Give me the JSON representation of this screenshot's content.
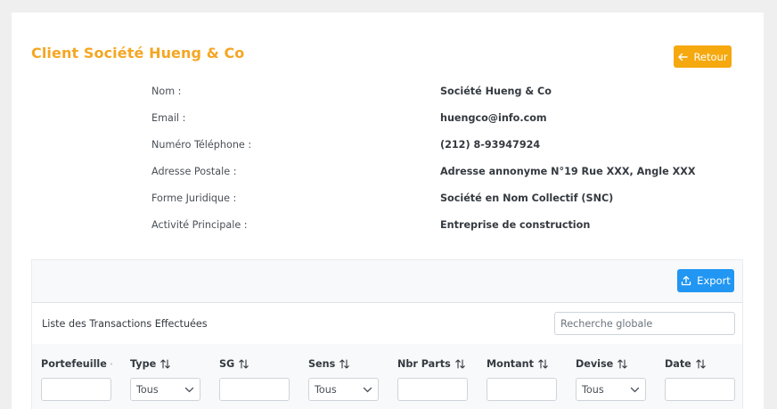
{
  "header": {
    "title": "Client Société Hueng & Co",
    "back_label": "Retour",
    "back_icon": "arrow-left-icon"
  },
  "client_info": [
    {
      "label": "Nom :",
      "value": "Société Hueng & Co"
    },
    {
      "label": "Email :",
      "value": "huengco@info.com"
    },
    {
      "label": "Numéro Téléphone :",
      "value": "(212) 8-93947924"
    },
    {
      "label": "Adresse Postale :",
      "value": "Adresse annonyme N°19 Rue XXX, Angle XXX"
    },
    {
      "label": "Forme Juridique :",
      "value": "Société en Nom Collectif (SNC)"
    },
    {
      "label": "Activité Principale :",
      "value": "Entreprise de construction"
    }
  ],
  "transactions": {
    "export_label": "Export",
    "export_icon": "upload-icon",
    "list_title": "Liste des Transactions Effectuées",
    "search_placeholder": "Recherche globale",
    "columns": [
      {
        "label": "Portefeuille",
        "filter": "input",
        "value": ""
      },
      {
        "label": "Type",
        "filter": "select",
        "value": "Tous"
      },
      {
        "label": "SG",
        "filter": "input",
        "value": ""
      },
      {
        "label": "Sens",
        "filter": "select",
        "value": "Tous"
      },
      {
        "label": "Nbr Parts",
        "filter": "input",
        "value": ""
      },
      {
        "label": "Montant",
        "filter": "input",
        "value": ""
      },
      {
        "label": "Devise",
        "filter": "select",
        "value": "Tous"
      },
      {
        "label": "Date",
        "filter": "input",
        "value": ""
      }
    ]
  },
  "colors": {
    "accent_orange": "#f5a623",
    "button_orange": "#f5a90f",
    "button_blue": "#2196f3"
  }
}
